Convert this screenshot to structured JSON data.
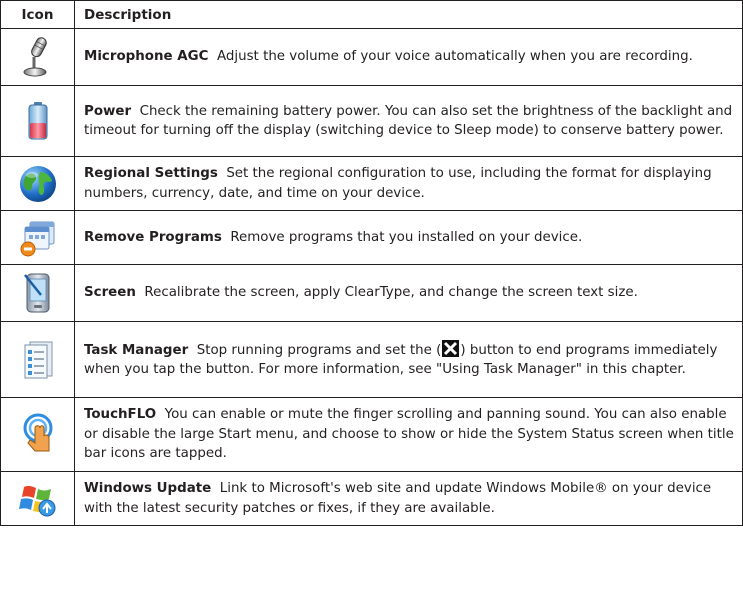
{
  "header": {
    "icon": "Icon",
    "description": "Description"
  },
  "rows": [
    {
      "icon": "microphone-icon",
      "title": "Microphone AGC",
      "text": "Adjust the volume of your voice automatically when you are recording."
    },
    {
      "icon": "battery-icon",
      "title": "Power",
      "text": "Check the remaining battery power. You can also set the brightness of the backlight and timeout for turning off the display (switching device to Sleep mode) to conserve battery power."
    },
    {
      "icon": "globe-icon",
      "title": "Regional Settings",
      "text": "Set the regional configuration to use, including the format for displaying numbers, currency, date, and time on your device."
    },
    {
      "icon": "remove-programs-icon",
      "title": "Remove Programs",
      "text": "Remove programs that you installed on your device."
    },
    {
      "icon": "screen-stylus-icon",
      "title": "Screen",
      "text": "Recalibrate the screen, apply ClearType, and change the screen text size."
    },
    {
      "icon": "task-manager-icon",
      "title": "Task Manager",
      "text_before": "Stop running programs and set the (",
      "text_after": ") button to end programs immediately when you tap the button. For more information, see \"Using Task Manager\" in this chapter."
    },
    {
      "icon": "touchflo-icon",
      "title": "TouchFLO",
      "text": "You can enable or mute the finger scrolling and panning sound. You can also enable or disable the large Start menu, and choose to show or hide the System Status screen when title bar icons are tapped."
    },
    {
      "icon": "windows-update-icon",
      "title": "Windows Update",
      "text": "Link to Microsoft's web site and update Windows Mobile® on your device with the latest security patches or fixes, if they are available."
    }
  ]
}
